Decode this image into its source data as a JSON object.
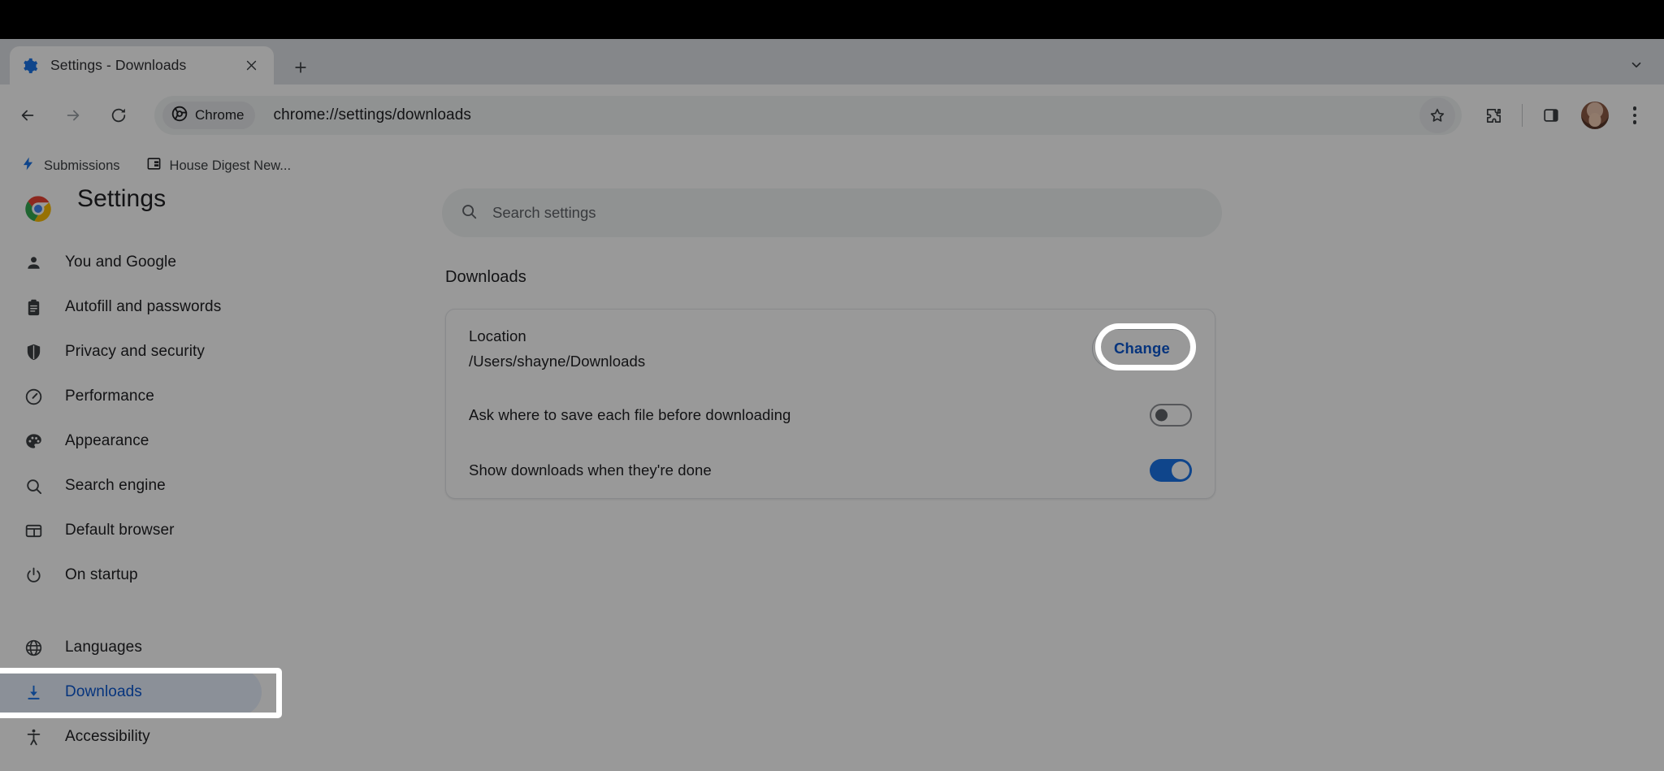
{
  "window": {
    "tab": {
      "title": "Settings - Downloads",
      "favicon_icon": "gear-icon",
      "close_icon": "close-icon"
    },
    "new_tab_icon": "plus-icon",
    "tab_search_icon": "chevron-down-icon"
  },
  "toolbar": {
    "back_icon": "arrow-left-icon",
    "forward_icon": "arrow-right-icon",
    "reload_icon": "reload-icon",
    "chrome_chip_label": "Chrome",
    "chrome_chip_icon": "chrome-icon",
    "url": "chrome://settings/downloads",
    "bookmark_icon": "star-icon",
    "extensions_icon": "puzzle-piece-icon",
    "side_panel_icon": "side-panel-icon",
    "profile_icon": "avatar-icon",
    "menu_icon": "three-dot-menu-icon"
  },
  "bookmarks_bar": {
    "items": [
      {
        "label": "Submissions",
        "icon": "lightning-bolt-icon"
      },
      {
        "label": "House Digest New...",
        "icon": "document-icon"
      }
    ]
  },
  "settings": {
    "logo_icon": "chrome-logo-icon",
    "title": "Settings",
    "search": {
      "placeholder": "Search settings",
      "icon": "search-icon",
      "value": ""
    },
    "sidebar": {
      "items": [
        {
          "label": "You and Google",
          "icon": "person-icon",
          "active": false
        },
        {
          "label": "Autofill and passwords",
          "icon": "clipboard-icon",
          "active": false
        },
        {
          "label": "Privacy and security",
          "icon": "shield-icon",
          "active": false
        },
        {
          "label": "Performance",
          "icon": "speedometer-icon",
          "active": false
        },
        {
          "label": "Appearance",
          "icon": "palette-icon",
          "active": false
        },
        {
          "label": "Search engine",
          "icon": "search-icon",
          "active": false
        },
        {
          "label": "Default browser",
          "icon": "browser-window-icon",
          "active": false
        },
        {
          "label": "On startup",
          "icon": "power-icon",
          "active": false
        },
        {
          "label": "Languages",
          "icon": "globe-icon",
          "active": false
        },
        {
          "label": "Downloads",
          "icon": "download-icon",
          "active": true
        },
        {
          "label": "Accessibility",
          "icon": "accessibility-icon",
          "active": false
        }
      ]
    },
    "main": {
      "section_title": "Downloads",
      "location": {
        "label": "Location",
        "path": "/Users/shayne/Downloads",
        "button_label": "Change"
      },
      "ask_where_to_save": {
        "label": "Ask where to save each file before downloading",
        "state": "off"
      },
      "show_downloads_done": {
        "label": "Show downloads when they're done",
        "state": "on"
      }
    }
  },
  "colors": {
    "accent_blue": "#0b57d0",
    "toggle_on": "#1a73e8",
    "active_pill": "#e8f0fe",
    "highlight_ring": "#ffffff"
  }
}
